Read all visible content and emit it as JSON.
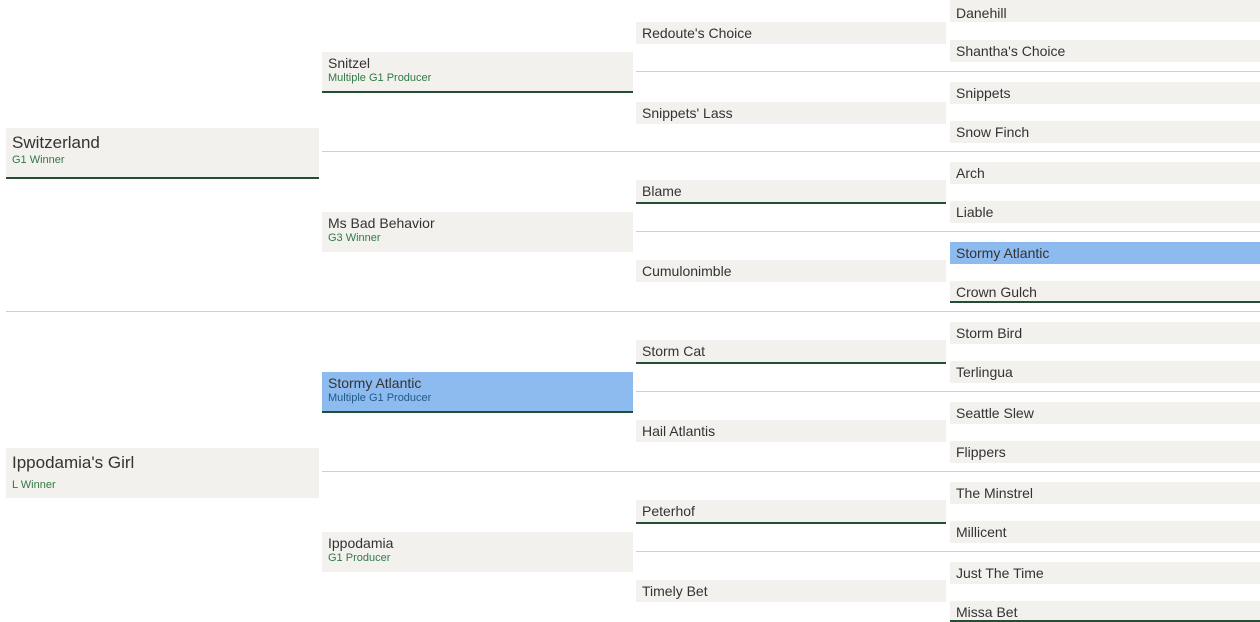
{
  "pedigree": {
    "sire": {
      "name": "Switzerland",
      "sub": "G1 Winner"
    },
    "dam": {
      "name": "Ippodamia's Girl",
      "sub": "L Winner"
    },
    "ss": {
      "name": "Snitzel",
      "sub": "Multiple G1 Producer"
    },
    "sd": {
      "name": "Ms Bad Behavior",
      "sub": "G3 Winner"
    },
    "ds": {
      "name": "Stormy Atlantic",
      "sub": "Multiple G1 Producer"
    },
    "dd": {
      "name": "Ippodamia",
      "sub": "G1 Producer"
    },
    "sss": {
      "name": "Redoute's Choice"
    },
    "ssd": {
      "name": "Snippets' Lass"
    },
    "sds": {
      "name": "Blame"
    },
    "sdd": {
      "name": "Cumulonimble"
    },
    "dss": {
      "name": "Storm Cat"
    },
    "dsd": {
      "name": "Hail Atlantis"
    },
    "dds": {
      "name": "Peterhof"
    },
    "ddd": {
      "name": "Timely Bet"
    },
    "ssss": {
      "name": "Danehill"
    },
    "sssd": {
      "name": "Shantha's Choice"
    },
    "ssds": {
      "name": "Snippets"
    },
    "ssdd": {
      "name": "Snow Finch"
    },
    "sdss": {
      "name": "Arch"
    },
    "sdsd": {
      "name": "Liable"
    },
    "sdds": {
      "name": "Stormy Atlantic"
    },
    "sddd": {
      "name": "Crown Gulch"
    },
    "dsss": {
      "name": "Storm Bird"
    },
    "dssd": {
      "name": "Terlingua"
    },
    "dsds": {
      "name": "Seattle Slew"
    },
    "dsdd": {
      "name": "Flippers"
    },
    "ddss": {
      "name": "The Minstrel"
    },
    "ddsd": {
      "name": "Millicent"
    },
    "ddds": {
      "name": "Just The Time"
    },
    "dddd": {
      "name": "Missa Bet"
    }
  }
}
